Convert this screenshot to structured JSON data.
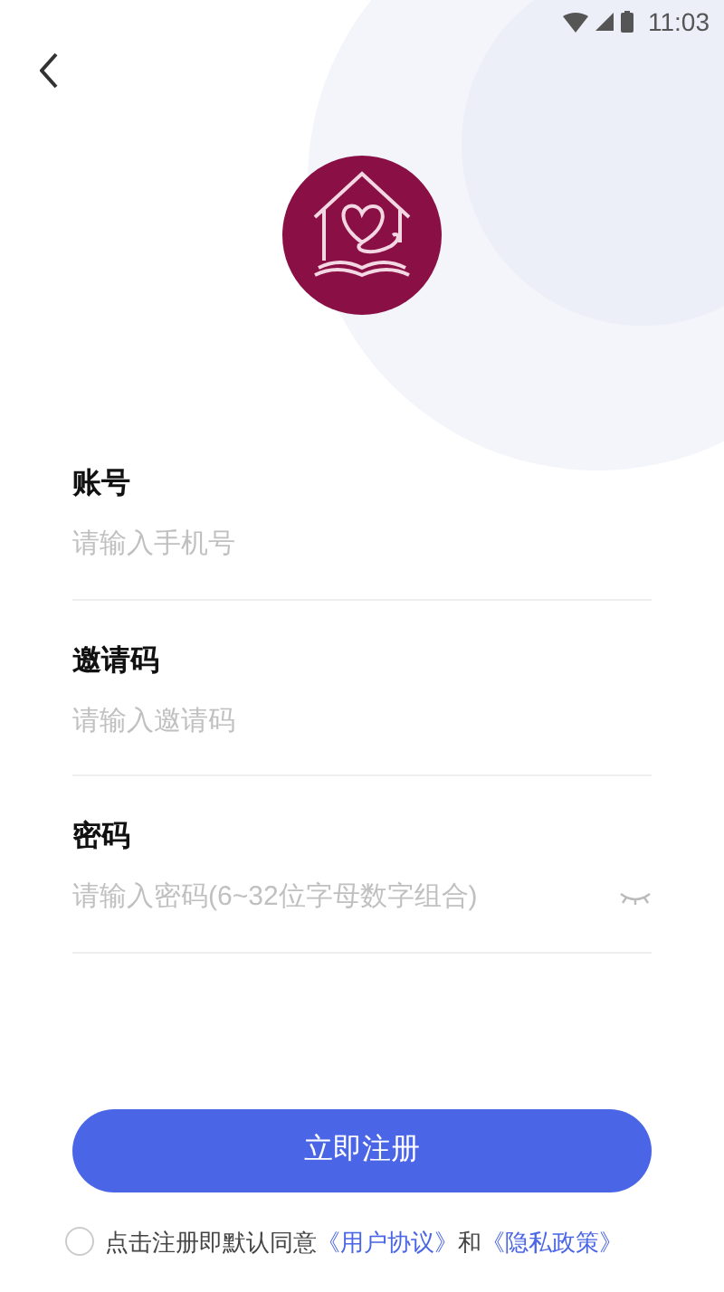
{
  "status_bar": {
    "time": "11:03"
  },
  "fields": [
    {
      "label": "账号",
      "placeholder": "请输入手机号",
      "kind": "text"
    },
    {
      "label": "邀请码",
      "placeholder": "请输入邀请码",
      "kind": "text"
    },
    {
      "label": "密码",
      "placeholder": "请输入密码(6~32位字母数字组合)",
      "kind": "password"
    }
  ],
  "submit_button": "立即注册",
  "agreement": {
    "checked": false,
    "text": "点击注册即默认同意",
    "link_1": "《用户协议》",
    "joiner": "和",
    "link_2": "《隐私政策》"
  }
}
